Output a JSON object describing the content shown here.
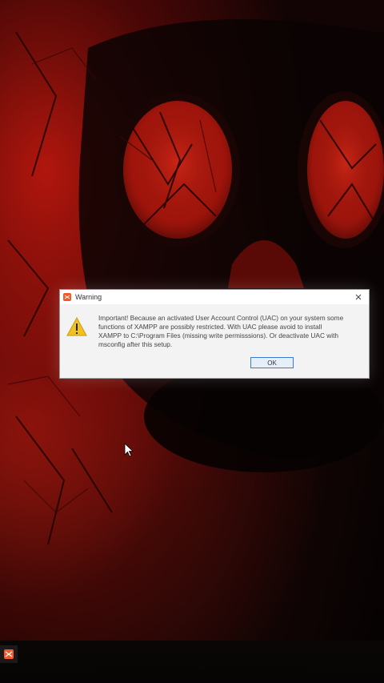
{
  "dialog": {
    "title": "Warning",
    "message": "Important! Because an activated User Account Control (UAC) on your system some functions of XAMPP are possibly restricted. With UAC please avoid to install XAMPP to C:\\Program Files (missing write permisssions). Or deactivate UAC with msconfig after this setup.",
    "ok_label": "OK",
    "close_icon": "close-icon",
    "app_icon": "xampp-icon",
    "warning_icon": "warning-icon"
  },
  "taskbar": {
    "pinned_app_icon": "xampp-icon"
  },
  "colors": {
    "dialog_bg": "#f3f3f3",
    "accent": "#3a7bd5",
    "xampp_orange": "#f05a28",
    "warning_yellow": "#f2c21c"
  }
}
